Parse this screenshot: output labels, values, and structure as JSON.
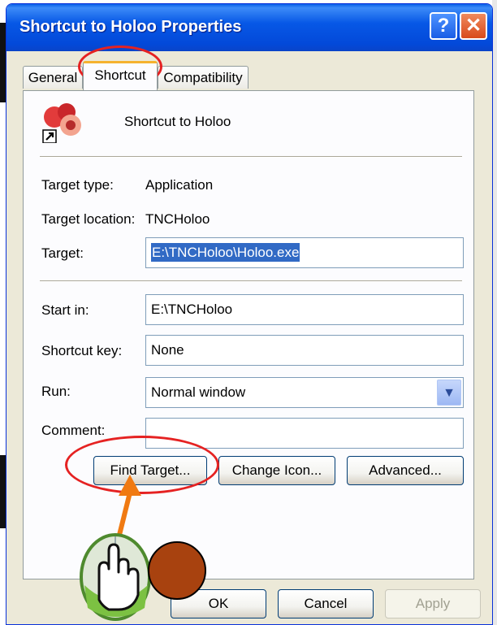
{
  "window": {
    "title": "Shortcut to Holoo Properties",
    "help_label": "?",
    "close_label": "✕"
  },
  "tabs": [
    {
      "label": "General"
    },
    {
      "label": "Shortcut"
    },
    {
      "label": "Compatibility"
    }
  ],
  "shortcut": {
    "name": "Shortcut to Holoo",
    "target_type_label": "Target type:",
    "target_type_value": "Application",
    "target_location_label": "Target location:",
    "target_location_value": "TNCHoloo",
    "target_label": "Target:",
    "target_value": "E:\\TNCHoloo\\Holoo.exe",
    "start_in_label": "Start in:",
    "start_in_value": "E:\\TNCHoloo",
    "shortcut_key_label": "Shortcut key:",
    "shortcut_key_value": "None",
    "run_label": "Run:",
    "run_value": "Normal window",
    "comment_label": "Comment:",
    "comment_value": ""
  },
  "buttons": {
    "find_target": "Find Target...",
    "change_icon": "Change Icon...",
    "advanced": "Advanced...",
    "ok": "OK",
    "cancel": "Cancel",
    "apply": "Apply"
  },
  "colors": {
    "titlebar": "#0758e6",
    "annotation_ring": "#e52222",
    "annotation_arrow": "#f07a12",
    "annotation_dot": "#a8420f"
  },
  "icons": {
    "app": "peach-holoo-icon",
    "shortcut_overlay": "shortcut-arrow-icon",
    "mouse": "mouse-pointer-hand-icon"
  }
}
